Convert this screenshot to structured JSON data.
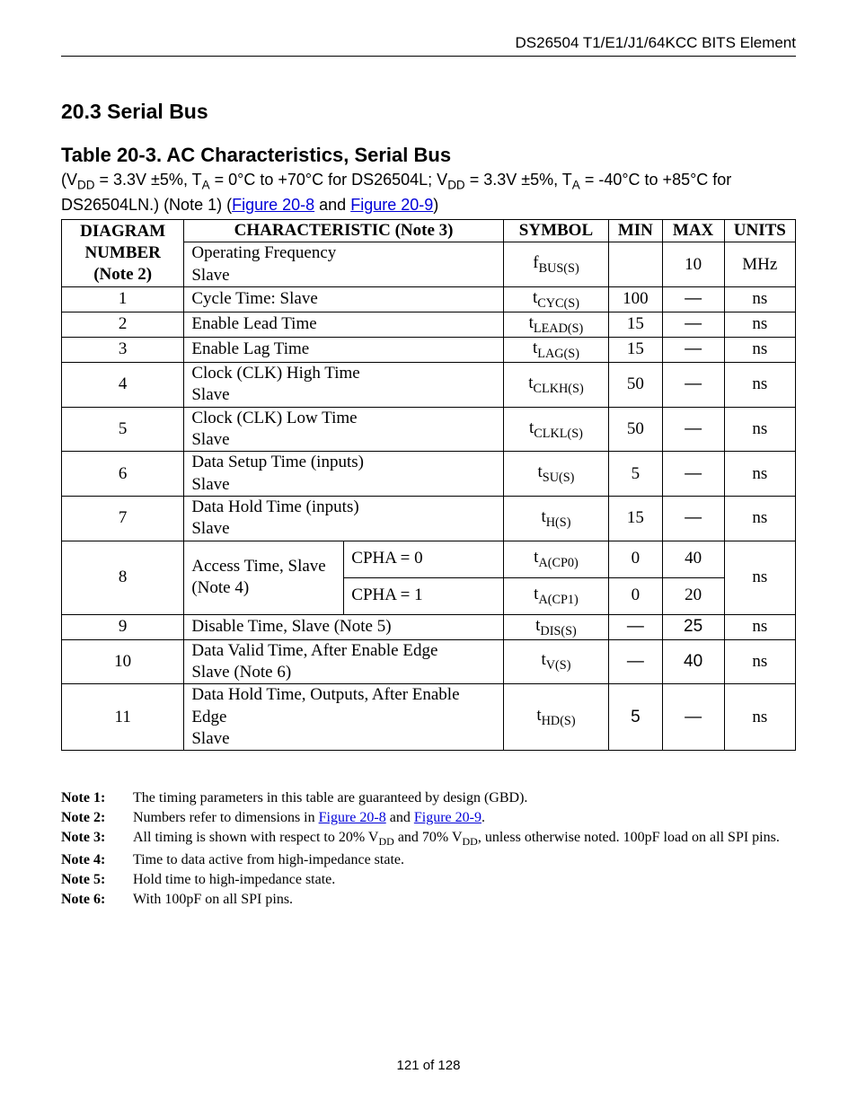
{
  "header": "DS26504 T1/E1/J1/64KCC BITS Element",
  "section_title": "20.3  Serial Bus",
  "table_title": "Table 20-3. AC Characteristics, Serial Bus",
  "conditions_html": "(V<sub>DD</sub> = 3.3V ±5%, T<sub>A</sub> = 0°C to +70°C for DS26504L; V<sub>DD</sub> = 3.3V ±5%, T<sub>A</sub> = -40°C to +85°C for DS26504LN.) (Note 1) (",
  "cond_link1": "Figure 20-8",
  "cond_mid": " and ",
  "cond_link2": "Figure 20-9",
  "cond_close": ")",
  "columns": {
    "diag_l1": "DIAGRAM",
    "diag_l2": "NUMBER",
    "diag_l3": "(Note 2)",
    "char": "CHARACTERISTIC (Note 3)",
    "sym": "SYMBOL",
    "min": "MIN",
    "max": "MAX",
    "units": "UNITS"
  },
  "rows": [
    {
      "num": "",
      "char_html": "Operating Frequency<br>Slave",
      "sym_html": "f<sub>BUS(S)</sub>",
      "min": "",
      "max": "10",
      "units": "MHz"
    },
    {
      "num": "1",
      "char_html": "Cycle Time: Slave",
      "sym_html": "t<sub>CYC(S)</sub>",
      "min": "100",
      "max": "—",
      "units": "ns"
    },
    {
      "num": "2",
      "char_html": "Enable Lead Time",
      "sym_html": "t<sub>LEAD(S)</sub>",
      "min": "15",
      "max": "—",
      "units": "ns"
    },
    {
      "num": "3",
      "char_html": "Enable Lag Time",
      "sym_html": "t<sub>LAG(S)</sub>",
      "min": "15",
      "max": "—",
      "units": "ns"
    },
    {
      "num": "4",
      "char_html": "Clock (CLK) High Time<br>Slave",
      "sym_html": "t<sub>CLKH(S)</sub>",
      "min": "50",
      "max": "—",
      "units": "ns"
    },
    {
      "num": "5",
      "char_html": "Clock (CLK) Low Time<br>Slave",
      "sym_html": "t<sub>CLKL(S)</sub>",
      "min": "50",
      "max": "—",
      "units": "ns"
    },
    {
      "num": "6",
      "char_html": "Data Setup Time (inputs)<br>Slave",
      "sym_html": "t<sub>SU(S)</sub>",
      "min": "5",
      "max": "—",
      "units": "ns"
    },
    {
      "num": "7",
      "char_html": "Data Hold Time (inputs)<br>Slave",
      "sym_html": "t<sub>H(S)</sub>",
      "min": "15",
      "max": "—",
      "units": "ns"
    }
  ],
  "row8": {
    "num": "8",
    "char_html": "Access Time, Slave<br>(Note 4)",
    "units": "ns",
    "sub": [
      {
        "c": "CPHA = 0",
        "sym_html": "t<sub>A(CP0)</sub>",
        "min": "0",
        "max": "40"
      },
      {
        "c": "CPHA = 1",
        "sym_html": "t<sub>A(CP1)</sub>",
        "min": "0",
        "max": "20"
      }
    ]
  },
  "rows2": [
    {
      "num": "9",
      "char_html": "Disable Time, Slave (Note 5)",
      "sym_html": "t<sub>DIS(S)</sub>",
      "min": "—",
      "max": "25",
      "units": "ns"
    },
    {
      "num": "10",
      "char_html": "Data Valid Time, After Enable Edge<br>Slave (Note 6)",
      "sym_html": "t<sub>V(S)</sub>",
      "min": "—",
      "max": "40",
      "units": "ns"
    },
    {
      "num": "11",
      "char_html": "Data Hold Time, Outputs, After Enable Edge<br>Slave",
      "sym_html": "t<sub>HD(S)</sub>",
      "min": "5",
      "max": "—",
      "units": "ns"
    }
  ],
  "notes": [
    {
      "label": "Note 1:",
      "text_html": "The timing parameters in this table are guaranteed by design (GBD)."
    },
    {
      "label": "Note 2:",
      "text_html": "Numbers refer to dimensions in <span class='link'>Figure 20-8</span> and <span class='link'>Figure 20-9</span>."
    },
    {
      "label": "Note 3:",
      "text_html": "All timing is shown with respect to 20% V<sub>DD</sub> and 70% V<sub>DD</sub>, unless otherwise noted. 100pF load on all SPI pins."
    },
    {
      "label": "Note 4:",
      "text_html": "Time to data active from high-impedance state."
    },
    {
      "label": "Note 5:",
      "text_html": "Hold time to high-impedance state."
    },
    {
      "label": "Note 6:",
      "text_html": "With 100pF on all SPI pins."
    }
  ],
  "footer": "121 of 128"
}
